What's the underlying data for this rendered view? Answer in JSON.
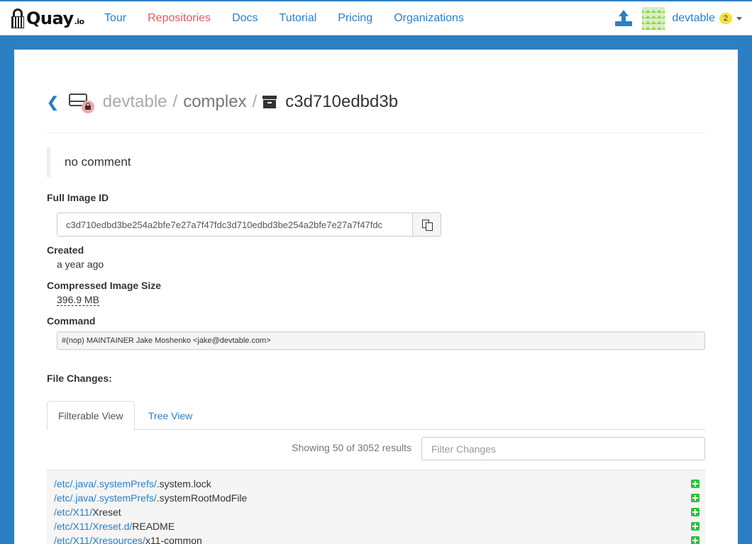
{
  "nav": {
    "brand": "Quay",
    "brand_suffix": ".io",
    "items": [
      {
        "label": "Tour",
        "active": false
      },
      {
        "label": "Repositories",
        "active": true
      },
      {
        "label": "Docs",
        "active": false
      },
      {
        "label": "Tutorial",
        "active": false
      },
      {
        "label": "Pricing",
        "active": false
      },
      {
        "label": "Organizations",
        "active": false
      }
    ],
    "username": "devtable",
    "notification_count": "2"
  },
  "breadcrumb": {
    "namespace": "devtable",
    "separator": "/",
    "repository": "complex",
    "image": "c3d710edbd3b"
  },
  "image": {
    "comment": "no comment",
    "full_id_label": "Full Image ID",
    "full_id": "c3d710edbd3be254a2bfe7e27a7f47fdc3d710edbd3be254a2bfe7e27a7f47fdc",
    "created_label": "Created",
    "created": "a year ago",
    "size_label": "Compressed Image Size",
    "size": "396.9 MB",
    "command_label": "Command",
    "command": "#(nop) MAINTAINER Jake Moshenko <jake@devtable.com>"
  },
  "file_changes": {
    "label": "File Changes:",
    "tabs": [
      {
        "label": "Filterable View",
        "active": true
      },
      {
        "label": "Tree View",
        "active": false
      }
    ],
    "results_text": "Showing 50 of 3052 results",
    "filter_placeholder": "Filter Changes",
    "rows": [
      {
        "segments": [
          "etc",
          ".java",
          ".systemPrefs"
        ],
        "leaf": ".system.lock",
        "kind": "added"
      },
      {
        "segments": [
          "etc",
          ".java",
          ".systemPrefs"
        ],
        "leaf": ".systemRootModFile",
        "kind": "added"
      },
      {
        "segments": [
          "etc",
          "X11"
        ],
        "leaf": "Xreset",
        "kind": "added"
      },
      {
        "segments": [
          "etc",
          "X11",
          "Xreset.d"
        ],
        "leaf": "README",
        "kind": "added"
      },
      {
        "segments": [
          "etc",
          "X11",
          "Xresources"
        ],
        "leaf": "x11-common",
        "kind": "added"
      }
    ]
  },
  "colors": {
    "accent": "#2c7fc2",
    "active_nav": "#e05a5a",
    "added": "#2fbf3a",
    "badge": "#f6e03d"
  }
}
